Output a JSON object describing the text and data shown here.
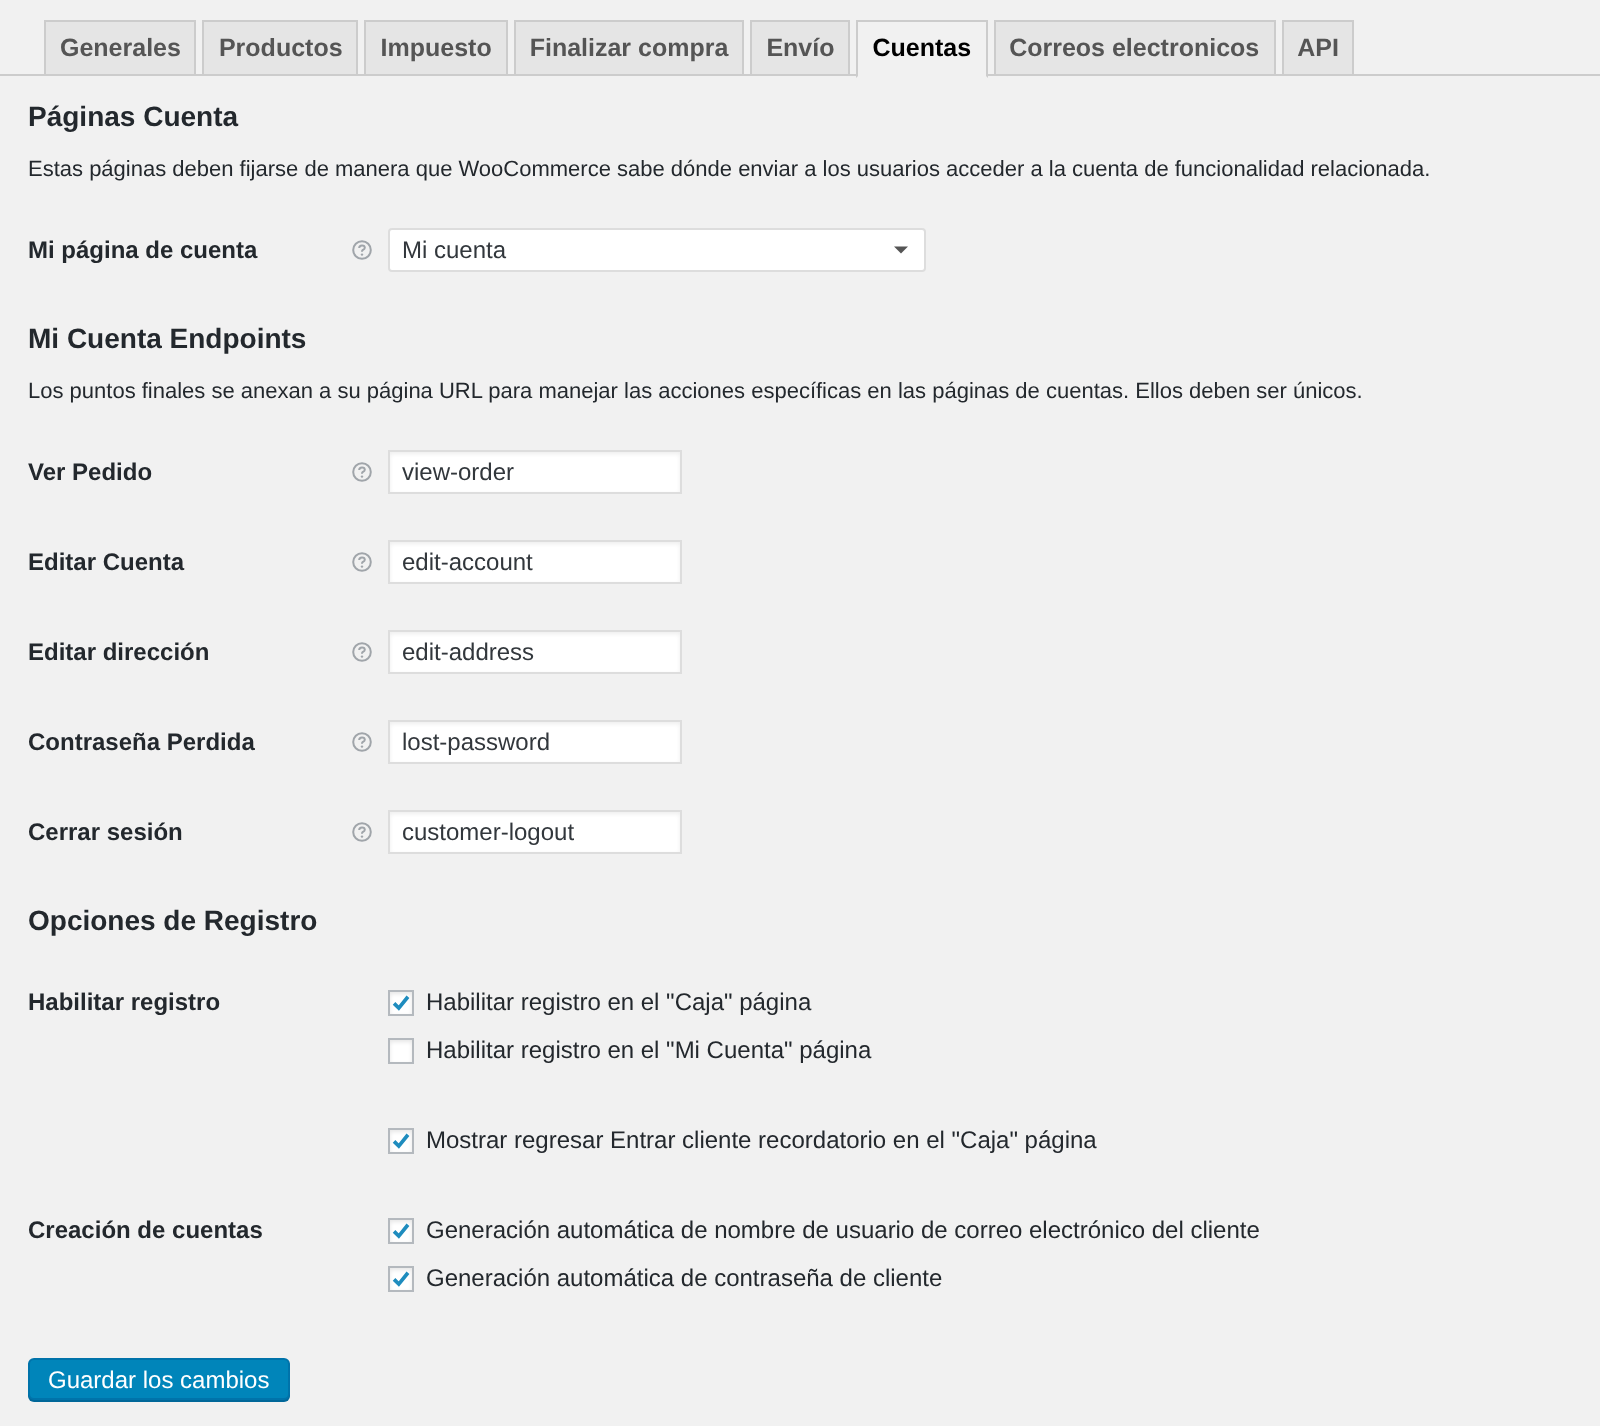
{
  "tabs": [
    {
      "label": "Generales",
      "selected": false
    },
    {
      "label": "Productos",
      "selected": false
    },
    {
      "label": "Impuesto",
      "selected": false
    },
    {
      "label": "Finalizar compra",
      "selected": false
    },
    {
      "label": "Envío",
      "selected": false
    },
    {
      "label": "Cuentas",
      "selected": true
    },
    {
      "label": "Correos electronicos",
      "selected": false
    },
    {
      "label": "API",
      "selected": false
    }
  ],
  "sections": [
    {
      "title": "Páginas Cuenta",
      "description": "Estas páginas deben fijarse de manera que WooCommerce sabe dónde enviar a los usuarios acceder a la cuenta de funcionalidad relacionada.",
      "fields": [
        {
          "kind": "select",
          "label": "Mi página de cuenta",
          "value": "Mi cuenta"
        }
      ]
    },
    {
      "title": "Mi Cuenta Endpoints",
      "description": "Los puntos finales se anexan a su página URL para manejar las acciones específicas en las páginas de cuentas. Ellos deben ser únicos.",
      "fields": [
        {
          "kind": "text",
          "label": "Ver Pedido",
          "value": "view-order"
        },
        {
          "kind": "text",
          "label": "Editar Cuenta",
          "value": "edit-account"
        },
        {
          "kind": "text",
          "label": "Editar dirección",
          "value": "edit-address"
        },
        {
          "kind": "text",
          "label": "Contraseña Perdida",
          "value": "lost-password"
        },
        {
          "kind": "text",
          "label": "Cerrar sesión",
          "value": "customer-logout"
        }
      ]
    },
    {
      "title": "Opciones de Registro",
      "fields": [
        {
          "kind": "checkboxes",
          "label": "Habilitar registro",
          "options": [
            {
              "label": "Habilitar registro en el \"Caja\" página",
              "checked": true
            },
            {
              "label": "Habilitar registro en el \"Mi Cuenta\" página",
              "checked": false
            }
          ]
        },
        {
          "kind": "checkboxes",
          "options": [
            {
              "label": "Mostrar regresar Entrar cliente recordatorio en el \"Caja\" página",
              "checked": true
            }
          ]
        },
        {
          "kind": "checkboxes",
          "label": "Creación de cuentas",
          "options": [
            {
              "label": "Generación automática de nombre de usuario de correo electrónico del cliente",
              "checked": true
            },
            {
              "label": "Generación automática de contraseña de cliente",
              "checked": true
            }
          ]
        }
      ]
    }
  ],
  "save_button": "Guardar los cambios"
}
